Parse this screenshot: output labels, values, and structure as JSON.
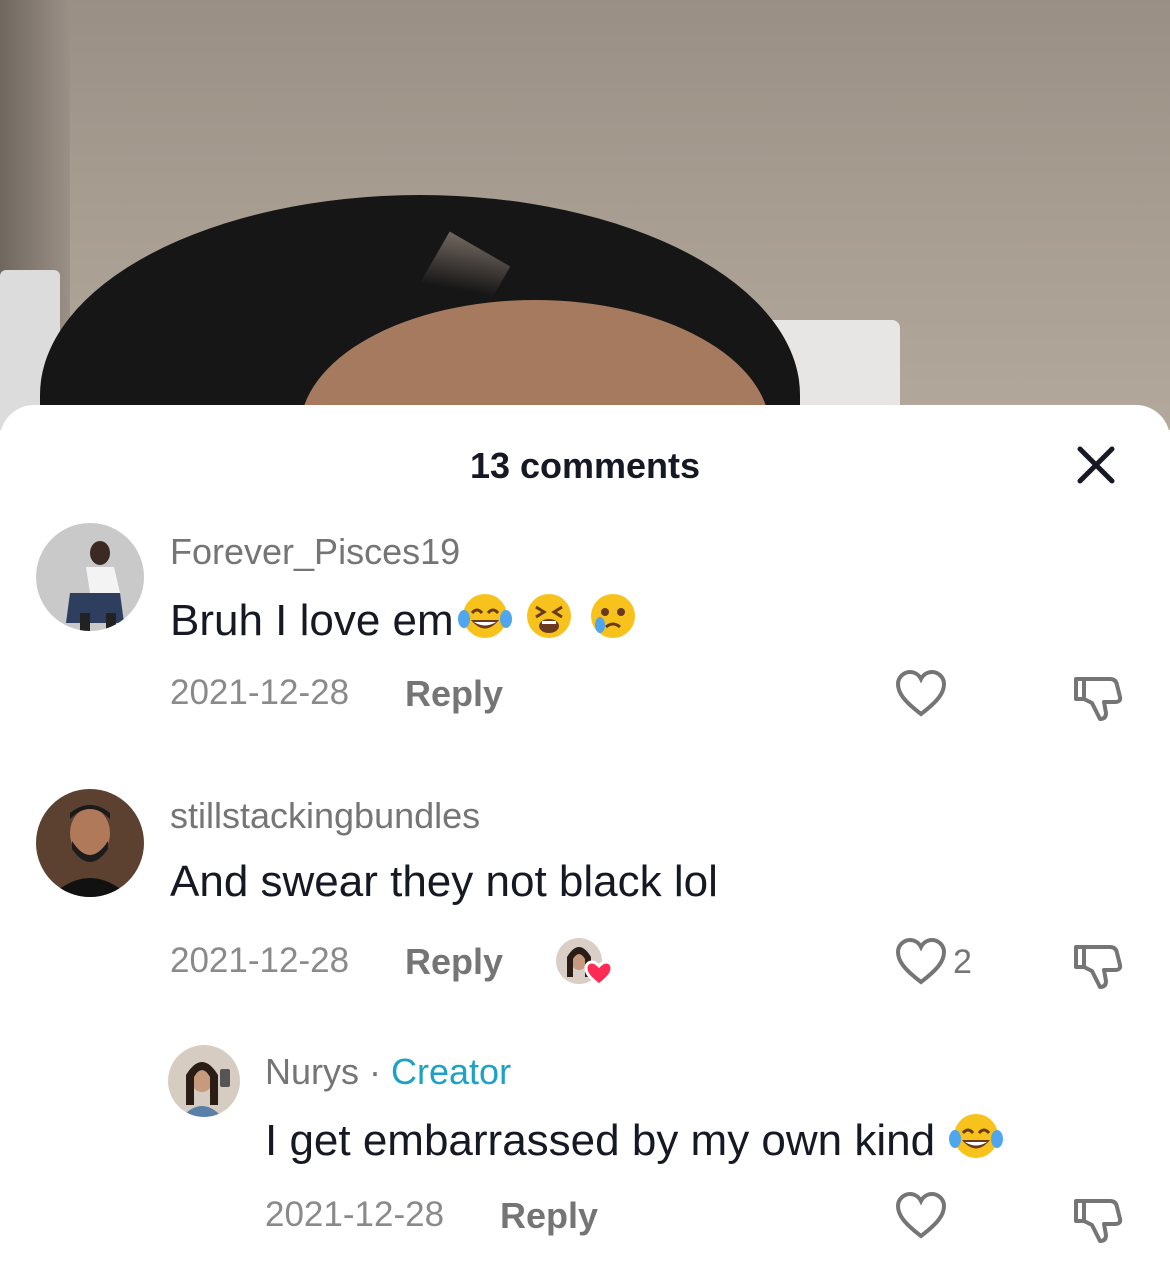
{
  "sheet": {
    "title": "13 comments"
  },
  "comments": [
    {
      "username": "Forever_Pisces19",
      "text": "Bruh I love em",
      "emojis": [
        "tears-of-joy",
        "tired-face",
        "holding-back-tears"
      ],
      "date": "2021-12-28",
      "reply_label": "Reply",
      "likes": ""
    },
    {
      "username": "stillstackingbundles",
      "text": "And swear they not black lol",
      "date": "2021-12-28",
      "reply_label": "Reply",
      "likes": "2",
      "liked_by_creator": true
    }
  ],
  "reply": {
    "username": "Nurys",
    "separator": " · ",
    "badge": "Creator",
    "text": "I get embarrassed by my own kind",
    "emojis": [
      "tears-of-joy"
    ],
    "date": "2021-12-28",
    "reply_label": "Reply"
  },
  "colors": {
    "creator_badge": "#1ea1c4",
    "heart_badge": "#fe2c55"
  }
}
